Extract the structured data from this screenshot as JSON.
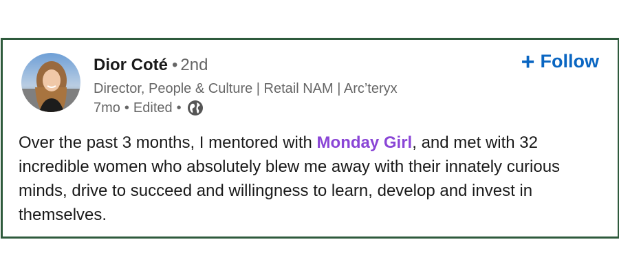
{
  "post": {
    "author": {
      "name": "Dior Coté",
      "separator": "•",
      "degree": "2nd",
      "headline": "Director, People & Culture | Retail NAM | Arc’teryx",
      "time": "7mo",
      "edited": "Edited",
      "visibility_icon": "globe-icon"
    },
    "follow": {
      "plus": "+",
      "label": "Follow"
    },
    "text": {
      "before": "Over the past 3 months, I mentored with ",
      "mention": "Monday Girl",
      "after": ", and met with 32 incredible women who absolutely blew me away with their innately curious minds, drive to succeed and willingness to learn, develop and invest in themselves."
    }
  },
  "colors": {
    "border": "#2e5a3c",
    "follow": "#0a66c2",
    "mention": "#8a46d6",
    "secondary_text": "#666666"
  }
}
